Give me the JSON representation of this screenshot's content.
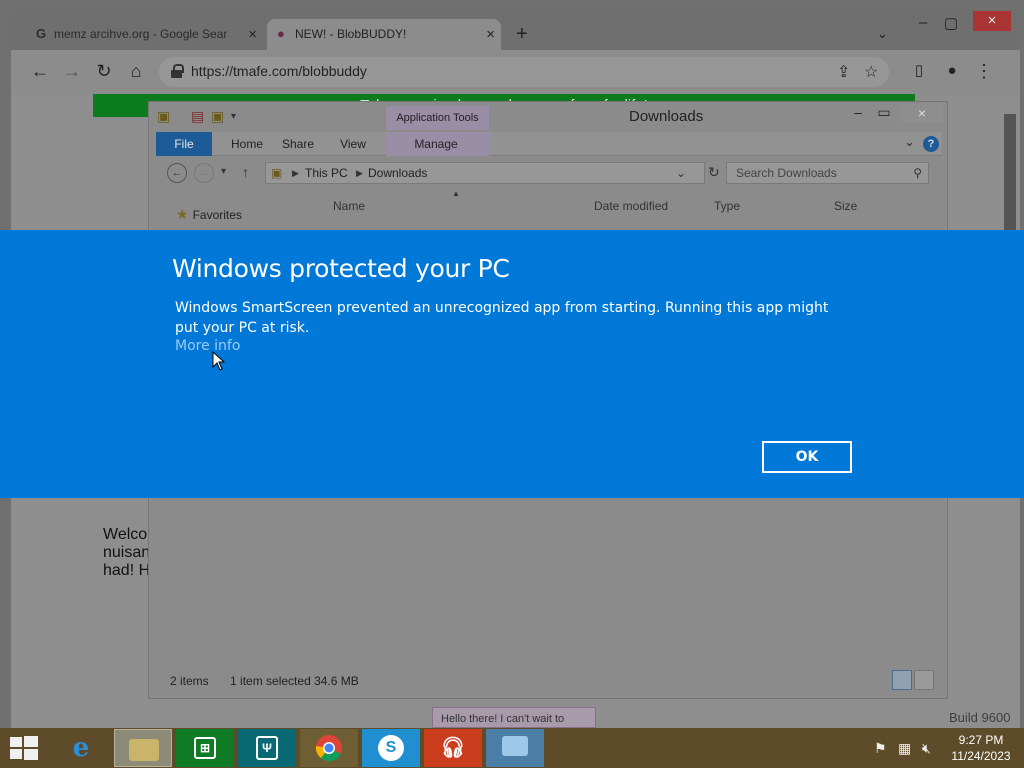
{
  "browser": {
    "tabs": [
      {
        "title": "memz arcihve.org - Google Sear",
        "favicon": "G"
      },
      {
        "title": "NEW! - BlobBUDDY!",
        "favicon": "●"
      }
    ],
    "new_tab": "+",
    "url": "https://tmafe.com/blobbuddy",
    "banner_text": "Take an animal around on your fun of a life!",
    "page_text_lines": [
      "Welco",
      "nuisan",
      "had!  H"
    ],
    "chat_bubble": "Hello there! I can't wait to"
  },
  "explorer": {
    "title": "Downloads",
    "application_tools": "Application Tools",
    "ribbon_tabs": [
      "File",
      "Home",
      "Share",
      "View",
      "Manage"
    ],
    "breadcrumb": [
      "This PC",
      "Downloads"
    ],
    "search_placeholder": "Search Downloads",
    "columns": [
      "Name",
      "Date modified",
      "Type",
      "Size"
    ],
    "favorites_label": "Favorites",
    "status_items": "2 items",
    "status_selected": "1 item selected  34.6 MB"
  },
  "smartscreen": {
    "title": "Windows protected your PC",
    "message": "Windows SmartScreen prevented an unrecognized app from starting. Running this app might put your PC at risk.",
    "more_info": "More info",
    "ok_label": "OK"
  },
  "taskbar": {
    "apps": [
      "internet-explorer",
      "file-explorer",
      "store",
      "maps",
      "chrome",
      "skype",
      "music",
      "control-panel"
    ],
    "time": "9:27 PM",
    "date": "11/24/2023"
  },
  "watermark": "Build 9600",
  "colors": {
    "smartscreen_blue": "#0078d7",
    "link_blue": "#9fcbef",
    "taskbar": "#5d4b2a"
  }
}
